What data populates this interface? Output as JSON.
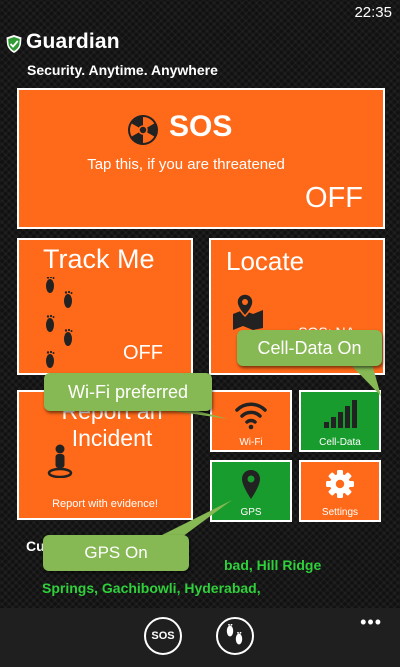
{
  "status_bar": {
    "time": "22:35"
  },
  "header": {
    "title": "Guardian",
    "tagline": "Security. Anytime. Anywhere"
  },
  "tiles": {
    "sos": {
      "title": "SOS",
      "subtitle": "Tap this, if you are threatened",
      "state": "OFF"
    },
    "track_me": {
      "title": "Track Me",
      "state": "OFF"
    },
    "locate": {
      "title": "Locate",
      "status": "SOS: NA"
    },
    "report": {
      "title_line1": "Report an",
      "title_line2": "Incident",
      "subtitle": "Report with evidence!"
    },
    "wifi": {
      "label": "Wi-Fi"
    },
    "cell_data": {
      "label": "Cell-Data"
    },
    "gps": {
      "label": "GPS"
    },
    "settings": {
      "label": "Settings"
    }
  },
  "location": {
    "label": "Cu",
    "line1": "bad, Hill Ridge",
    "line2": "Springs, Gachibowli, Hyderabad,"
  },
  "callouts": {
    "cell_data": "Cell-Data On",
    "wifi": "Wi-Fi preferred",
    "gps": "GPS On"
  },
  "app_bar": {
    "sos_label": "SOS",
    "more_label": "•••"
  },
  "colors": {
    "tile_orange": "#ff6a1a",
    "tile_green": "#199c2e",
    "callout_green": "#86b853",
    "location_text": "#2fd13b"
  }
}
